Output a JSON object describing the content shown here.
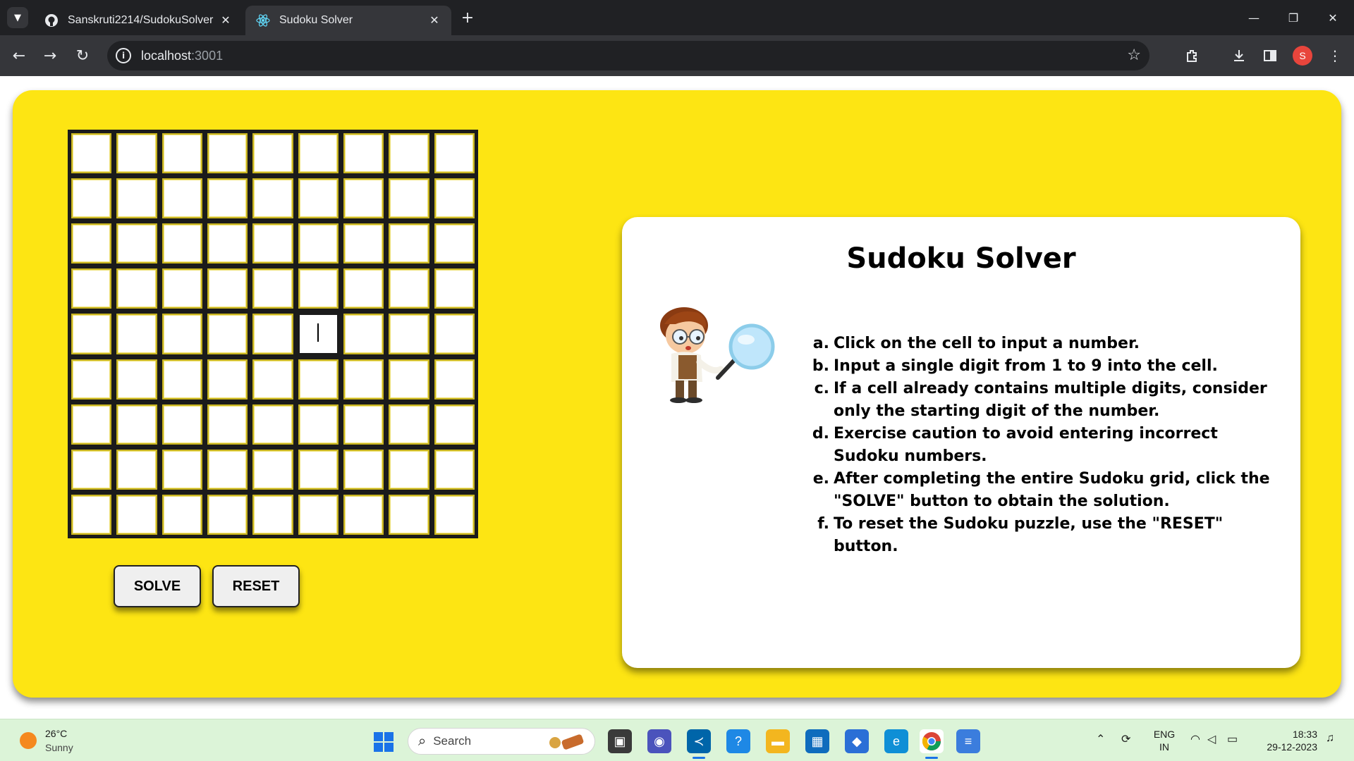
{
  "browser": {
    "tabs": [
      {
        "title": "Sanskruti2214/SudokuSolver",
        "icon": "github-icon",
        "active": false
      },
      {
        "title": "Sudoku Solver",
        "icon": "react-icon",
        "active": true
      }
    ],
    "url_host": "localhost",
    "url_port": ":3001",
    "profile_initial": "S"
  },
  "app": {
    "title": "Sudoku Solver",
    "buttons": {
      "solve": "SOLVE",
      "reset": "RESET"
    },
    "grid": {
      "rows": 9,
      "cols": 9,
      "focused_cell": {
        "row": 5,
        "col": 6
      }
    },
    "colors": {
      "panel": "#fde513",
      "grid_border": "#1b1b1b",
      "cell_border": "#c8b420"
    },
    "instructions": [
      {
        "marker": "a.",
        "text": "Click on the cell to input a number."
      },
      {
        "marker": "b.",
        "text": "Input a single digit from 1 to 9 into the cell."
      },
      {
        "marker": "c.",
        "text": "If a cell already contains multiple digits, consider only the starting digit of the number."
      },
      {
        "marker": "d.",
        "text": "Exercise caution to avoid entering incorrect Sudoku numbers."
      },
      {
        "marker": "e.",
        "text": "After completing the entire Sudoku grid, click the \"SOLVE\" button to obtain the solution."
      },
      {
        "marker": "f.",
        "text": "To reset the Sudoku puzzle, use the \"RESET\" button."
      }
    ]
  },
  "taskbar": {
    "weather": {
      "temp": "26°C",
      "desc": "Sunny"
    },
    "search_placeholder": "Search",
    "language": {
      "line1": "ENG",
      "line2": "IN"
    },
    "time": "18:33",
    "date": "29-12-2023",
    "chrome_badge": "S"
  }
}
